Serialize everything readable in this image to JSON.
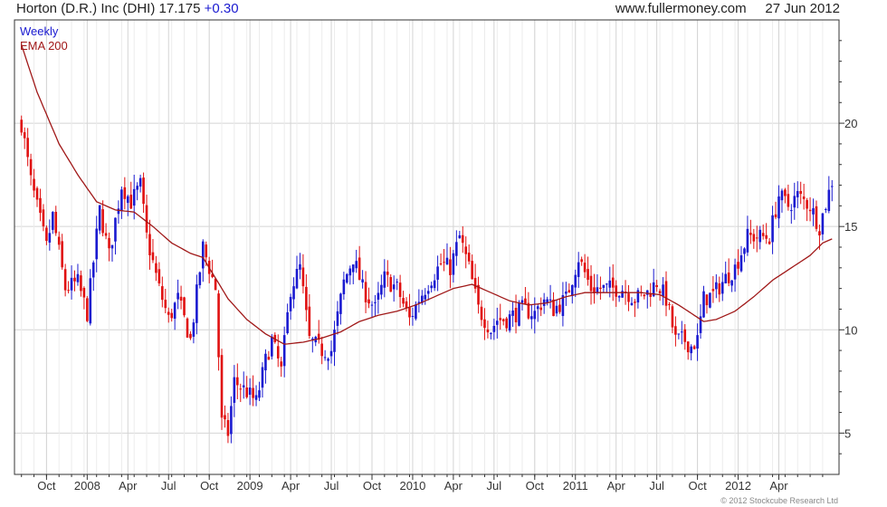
{
  "header": {
    "ticker": "Horton (D.R.) Inc (DHI)",
    "price": "17.175",
    "change": "+0.30",
    "site": "www.fullermoney.com",
    "date": "27 Jun 2012"
  },
  "legend": {
    "period": "Weekly",
    "indicator": "EMA 200"
  },
  "copyright": "© 2012 Stockcube Research Ltd",
  "colors": {
    "up": "#1a1ad0",
    "down": "#e01010",
    "ema": "#a01818",
    "grid": "#d4d4d4",
    "frame": "#333333"
  },
  "chart_data": {
    "type": "candlestick",
    "ylim": [
      3,
      25
    ],
    "y_ticks": [
      5,
      10,
      15,
      20
    ],
    "x_ticks": [
      "Oct",
      "2008",
      "Apr",
      "Jul",
      "Oct",
      "2009",
      "Apr",
      "Jul",
      "Oct",
      "2010",
      "Apr",
      "Jul",
      "Oct",
      "2011",
      "Apr",
      "Jul",
      "Oct",
      "2012",
      "Apr"
    ],
    "x_tick_index": [
      8,
      21,
      34,
      47,
      60,
      73,
      86,
      99,
      112,
      125,
      138,
      151,
      164,
      177,
      190,
      203,
      216,
      229,
      242
    ],
    "weeks": 260,
    "grid": true,
    "price_path": [
      [
        0,
        20
      ],
      [
        3,
        17.2
      ],
      [
        8,
        14
      ],
      [
        10,
        15.5
      ],
      [
        14,
        12
      ],
      [
        18,
        12.3
      ],
      [
        21,
        10.8
      ],
      [
        25,
        15.8
      ],
      [
        28,
        13.6
      ],
      [
        32,
        17
      ],
      [
        35,
        16.2
      ],
      [
        38,
        17
      ],
      [
        40,
        14.5
      ],
      [
        44,
        12
      ],
      [
        47,
        10.5
      ],
      [
        50,
        11.5
      ],
      [
        54,
        9.5
      ],
      [
        58,
        14
      ],
      [
        62,
        12
      ],
      [
        64,
        5.5
      ],
      [
        66,
        5
      ],
      [
        68,
        7.5
      ],
      [
        72,
        7
      ],
      [
        75,
        6.5
      ],
      [
        78,
        8.5
      ],
      [
        80,
        9.5
      ],
      [
        83,
        8
      ],
      [
        86,
        12
      ],
      [
        89,
        13
      ],
      [
        92,
        9.5
      ],
      [
        96,
        9
      ],
      [
        99,
        9
      ],
      [
        103,
        12.3
      ],
      [
        106,
        13.5
      ],
      [
        109,
        12
      ],
      [
        113,
        11
      ],
      [
        116,
        12.5
      ],
      [
        120,
        12
      ],
      [
        124,
        10.5
      ],
      [
        127,
        11.5
      ],
      [
        131,
        12.5
      ],
      [
        134,
        13.2
      ],
      [
        137,
        13
      ],
      [
        140,
        14.5
      ],
      [
        143,
        13
      ],
      [
        146,
        11
      ],
      [
        150,
        10
      ],
      [
        152,
        10.5
      ],
      [
        155,
        10.5
      ],
      [
        160,
        11
      ],
      [
        164,
        10.8
      ],
      [
        167,
        11.5
      ],
      [
        170,
        11
      ],
      [
        174,
        11.5
      ],
      [
        178,
        13.5
      ],
      [
        182,
        12
      ],
      [
        185,
        12
      ],
      [
        188,
        12
      ],
      [
        192,
        12
      ],
      [
        196,
        11.5
      ],
      [
        200,
        11.8
      ],
      [
        203,
        12.3
      ],
      [
        206,
        11.5
      ],
      [
        209,
        9.5
      ],
      [
        212,
        9.5
      ],
      [
        214,
        9.2
      ],
      [
        216,
        9.5
      ],
      [
        218,
        11.5
      ],
      [
        221,
        11.7
      ],
      [
        225,
        12.5
      ],
      [
        228,
        13
      ],
      [
        232,
        14.5
      ],
      [
        236,
        14.5
      ],
      [
        239,
        14.5
      ],
      [
        242,
        16.5
      ],
      [
        245,
        16
      ],
      [
        248,
        16.5
      ],
      [
        252,
        16
      ],
      [
        255,
        15
      ],
      [
        259,
        17.2
      ]
    ],
    "ema_path": [
      [
        0,
        23.8
      ],
      [
        5,
        21.5
      ],
      [
        12,
        19
      ],
      [
        18,
        17.5
      ],
      [
        24,
        16.2
      ],
      [
        30,
        15.8
      ],
      [
        36,
        15.7
      ],
      [
        42,
        15
      ],
      [
        48,
        14.2
      ],
      [
        54,
        13.7
      ],
      [
        58,
        13.5
      ],
      [
        62,
        12.5
      ],
      [
        66,
        11.5
      ],
      [
        72,
        10.5
      ],
      [
        78,
        9.8
      ],
      [
        84,
        9.3
      ],
      [
        90,
        9.4
      ],
      [
        96,
        9.6
      ],
      [
        102,
        9.9
      ],
      [
        108,
        10.4
      ],
      [
        114,
        10.7
      ],
      [
        120,
        10.9
      ],
      [
        126,
        11.2
      ],
      [
        132,
        11.6
      ],
      [
        138,
        12
      ],
      [
        144,
        12.2
      ],
      [
        150,
        11.8
      ],
      [
        156,
        11.4
      ],
      [
        162,
        11.2
      ],
      [
        168,
        11.3
      ],
      [
        174,
        11.6
      ],
      [
        180,
        11.8
      ],
      [
        186,
        11.8
      ],
      [
        192,
        11.8
      ],
      [
        198,
        11.8
      ],
      [
        204,
        11.7
      ],
      [
        210,
        11.2
      ],
      [
        214,
        10.8
      ],
      [
        218,
        10.4
      ],
      [
        222,
        10.5
      ],
      [
        228,
        10.9
      ],
      [
        234,
        11.6
      ],
      [
        240,
        12.4
      ],
      [
        246,
        13
      ],
      [
        252,
        13.6
      ],
      [
        256,
        14.2
      ],
      [
        259,
        14.4
      ]
    ]
  }
}
